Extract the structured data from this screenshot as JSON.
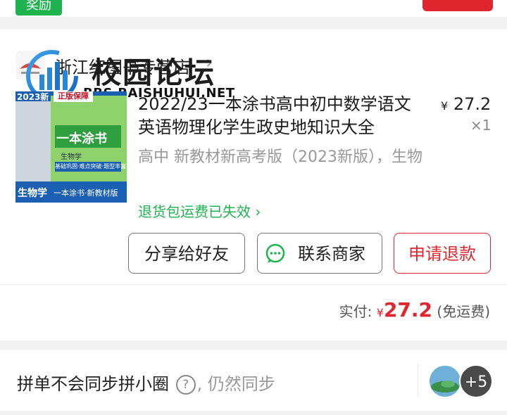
{
  "top": {
    "reward_label": "奖励"
  },
  "watermark": {
    "title": "校园论坛",
    "subtitle": "BBS.BAISHUHUI.NET"
  },
  "shop": {
    "name": "浙江红图书专营店",
    "arrow": "›"
  },
  "product": {
    "title": "2022/23一本涂书高中初中数学语文英语物理化学生政史地知识大全",
    "spec": "高中 新教材新高考版（2023新版），生物",
    "currency": "¥",
    "price": "27.2",
    "quantity": "×1",
    "return_info": "退货包运费已失效",
    "return_arrow": "›",
    "cover_text": {
      "year_badge": "2023新",
      "guarantee": "正版保障",
      "book_title": "一本涂书",
      "subject_small": "生物学",
      "features": "基础巩固·难点突破·题型丰富",
      "subject": "生物学",
      "series": "一本涂书·新教材版"
    }
  },
  "actions": {
    "share_label": "分享给好友",
    "contact_label": "联系商家",
    "refund_label": "申请退款"
  },
  "payment": {
    "label": "实付:",
    "currency": "¥",
    "amount": "27.2",
    "note": "(免运费)"
  },
  "group": {
    "text": "拼单不会同步拼小圈",
    "help": "?",
    "suffix": ", 仍然同步",
    "more_count": "+5"
  },
  "colors": {
    "accent_red": "#e0262e",
    "accent_green": "#1fb34f",
    "background": "#f2f2f2"
  }
}
